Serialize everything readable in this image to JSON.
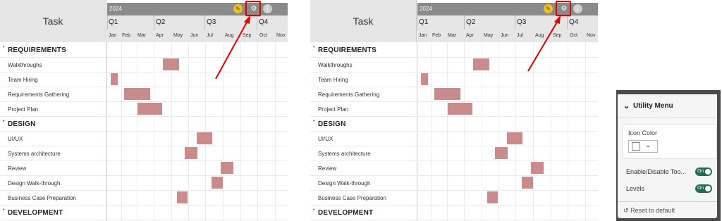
{
  "panels": [
    {
      "task_header": "Task",
      "year": "2024",
      "quarters": [
        "Q1",
        "Q2",
        "Q3",
        "Q4"
      ],
      "months": [
        "Jan",
        "Feb",
        "Mar",
        "Apr",
        "May",
        "Jun",
        "Jul",
        "Aug",
        "Sep",
        "Oct",
        "Nov"
      ],
      "rows": [
        {
          "type": "group",
          "label": "REQUIREMENTS"
        },
        {
          "type": "task",
          "label": "Walkthroughs"
        },
        {
          "type": "task",
          "label": "Team Hiring"
        },
        {
          "type": "task",
          "label": "Requirements Gathering"
        },
        {
          "type": "task",
          "label": "Project Plan"
        },
        {
          "type": "group",
          "label": "DESIGN"
        },
        {
          "type": "task",
          "label": "UI/UX"
        },
        {
          "type": "task",
          "label": "Systems architecture"
        },
        {
          "type": "task",
          "label": "Review"
        },
        {
          "type": "task",
          "label": "Design Walk-through"
        },
        {
          "type": "task",
          "label": "Business Case Preparation"
        },
        {
          "type": "group",
          "label": "DEVELOPMENT"
        }
      ]
    },
    {
      "task_header": "Task",
      "year": "2024",
      "quarters": [
        "Q1",
        "Q2",
        "Q3",
        "Q4"
      ],
      "months": [
        "Jan",
        "Feb",
        "Mar",
        "Apr",
        "May",
        "Jun",
        "Jul",
        "Aug",
        "Sep",
        "Oct",
        "Nov"
      ],
      "rows": [
        {
          "type": "group",
          "label": "REQUIREMENTS"
        },
        {
          "type": "task",
          "label": "Walkthroughs"
        },
        {
          "type": "task",
          "label": "Team Hiring"
        },
        {
          "type": "task",
          "label": "Requirements Gathering"
        },
        {
          "type": "task",
          "label": "Project Plan"
        },
        {
          "type": "group",
          "label": "DESIGN"
        },
        {
          "type": "task",
          "label": "UI/UX"
        },
        {
          "type": "task",
          "label": "Systems architecture"
        },
        {
          "type": "task",
          "label": "Review"
        },
        {
          "type": "task",
          "label": "Design Walk-through"
        },
        {
          "type": "task",
          "label": "Business Case Preparation"
        },
        {
          "type": "group",
          "label": "DEVELOPMENT"
        }
      ]
    }
  ],
  "toolbar_icons": [
    "pencil-icon",
    "gear-icon",
    "info-icon"
  ],
  "bar_color": "#c98b8b",
  "highlight_color": "#e00000",
  "utility_menu": {
    "title": "Utility Menu",
    "icon_color_label": "Icon Color",
    "options": [
      {
        "label": "Enable/Disable Too...",
        "toggle": "On"
      },
      {
        "label": "Levels",
        "toggle": "On"
      }
    ],
    "reset_label": "Reset to default"
  }
}
